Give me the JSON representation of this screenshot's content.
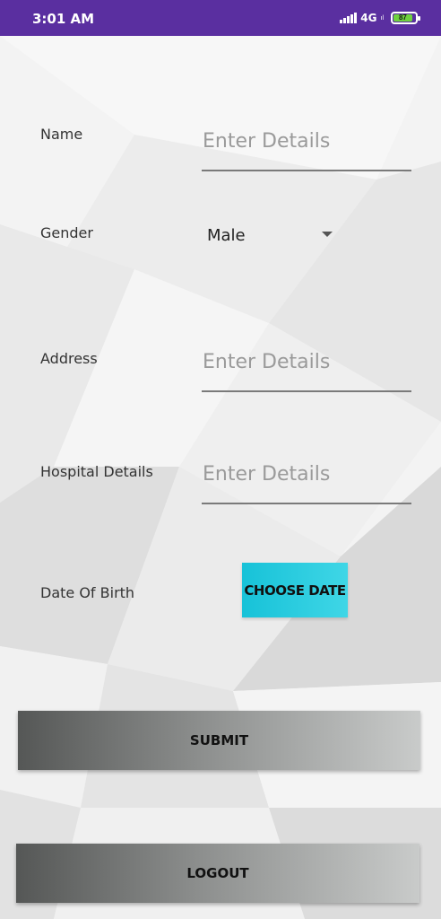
{
  "status_bar": {
    "time": "3:01 AM",
    "network": "4G",
    "network_sub": "ıl",
    "battery": "87"
  },
  "form": {
    "name_label": "Name",
    "name_placeholder": "Enter Details",
    "gender_label": "Gender",
    "gender_value": "Male",
    "address_label": "Address",
    "address_placeholder": "Enter Details",
    "hospital_label": "Hospital Details",
    "hospital_placeholder": "Enter Details",
    "dob_label": "Date Of Birth",
    "choose_date_label": "CHOOSE DATE"
  },
  "actions": {
    "submit_label": "SUBMIT",
    "logout_label": "LOGOUT"
  },
  "colors": {
    "status_bar": "#5a2fa0",
    "choose_date": "#17c2d8",
    "battery": "#6fd23f"
  },
  "icons": {
    "signal": "signal-bars-icon",
    "battery": "battery-icon",
    "dropdown": "dropdown-arrow-icon"
  }
}
